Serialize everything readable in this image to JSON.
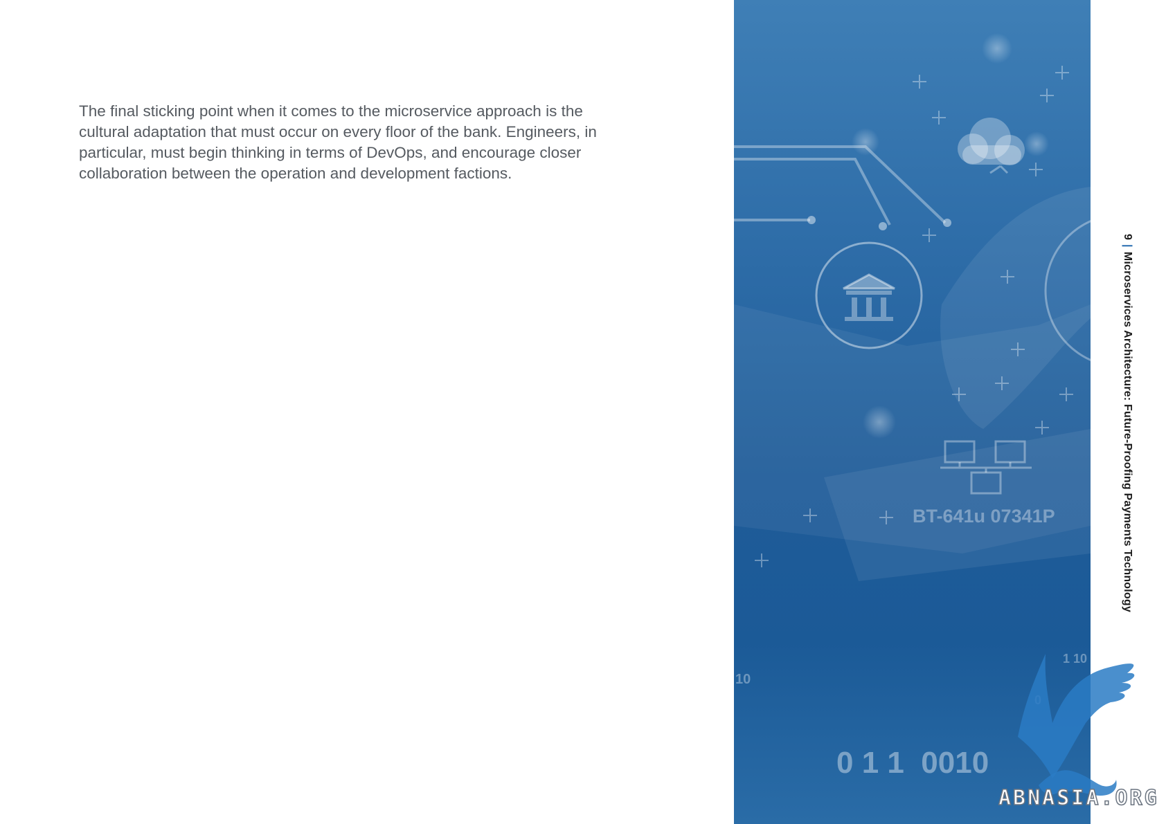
{
  "document": {
    "paragraph": "The final sticking point when it comes to the microservice approach is the cultural adaptation that must occur on every floor of the bank. Engineers, in particular, must begin thinking in terms of DevOps, and encourage closer collaboration between the operation and development factions."
  },
  "side_header": {
    "page_number": "9",
    "separator": "|",
    "title": "Microservices Architecture: Future-Proofing Payments Technology"
  },
  "hero_image": {
    "description_icons": [
      "bank-icon",
      "cloud-icon",
      "network-computers-icon",
      "hand-holding-card"
    ],
    "card_text": "BT-641u 07341P",
    "binary_text": "0 1 1  0010",
    "side_digits": "10",
    "corner_digits": "1 10",
    "small_digit": "0"
  },
  "watermark": {
    "text": "ABNASIA.ORG"
  },
  "colors": {
    "hero_blue": "#2f6ea9",
    "accent_blue": "#2a6fb1",
    "body_text": "#555a60"
  }
}
